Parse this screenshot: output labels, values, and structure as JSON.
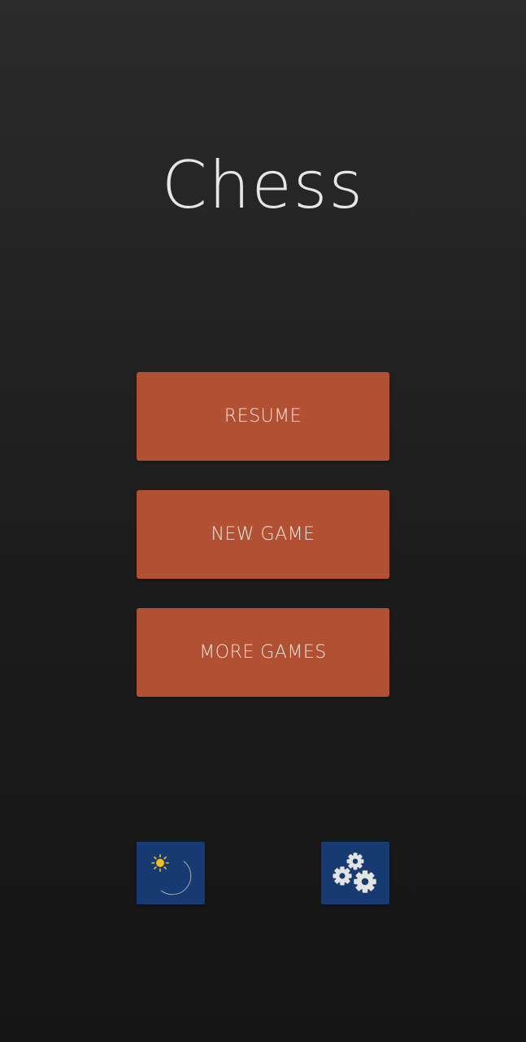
{
  "app": {
    "title": "Chess"
  },
  "menu": {
    "resume_label": "RESUME",
    "new_game_label": "NEW GAME",
    "more_games_label": "MORE GAMES"
  },
  "toolbar": {
    "theme_icon": "day-night-icon",
    "settings_icon": "gears-icon"
  },
  "colors": {
    "background_top": "#2b2b2b",
    "background_bottom": "#151515",
    "button_accent": "#b25034",
    "icon_button_bg": "#173a72",
    "title_text": "#e6e6e6"
  }
}
